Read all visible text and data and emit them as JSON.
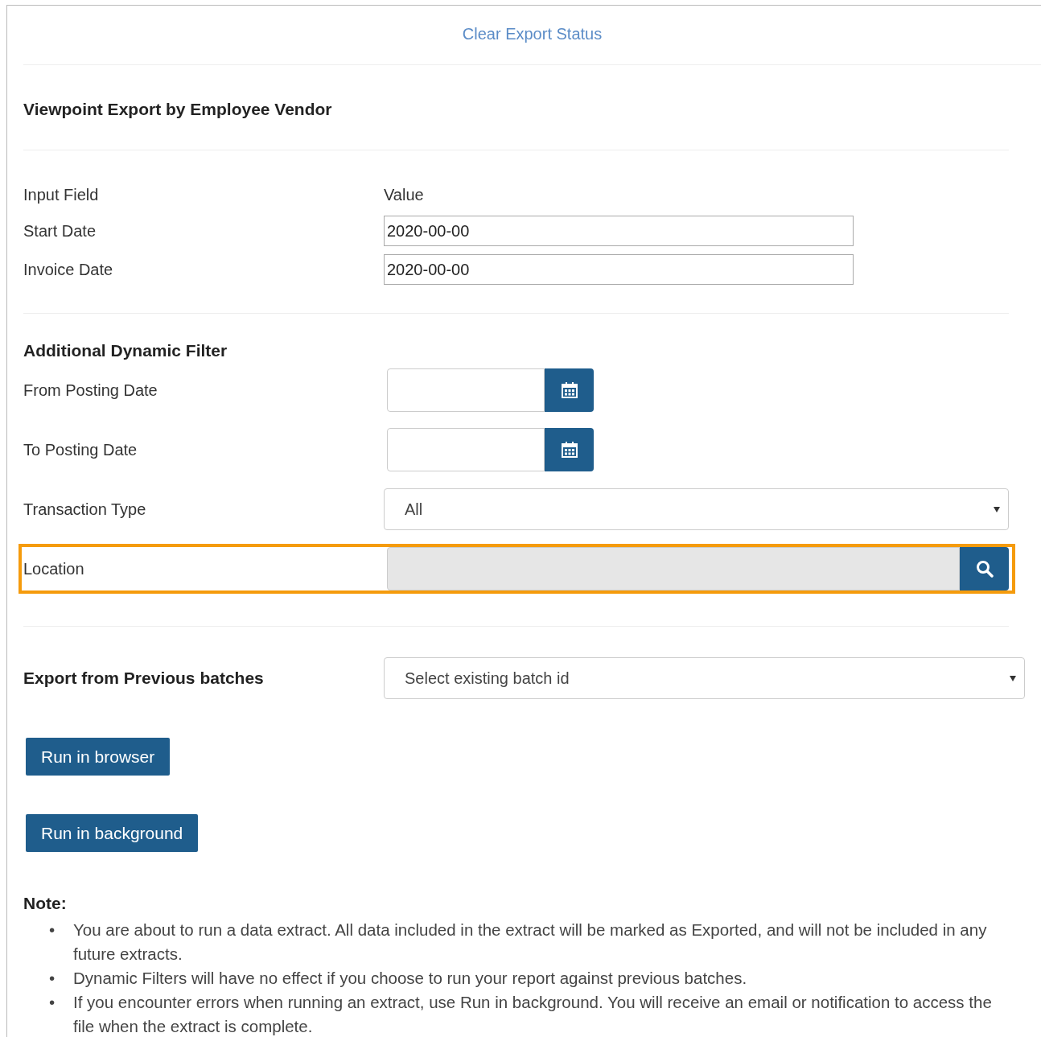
{
  "header": {
    "link": "Clear Export Status"
  },
  "export": {
    "title": "Viewpoint Export by Employee Vendor",
    "columns": [
      "Input Field",
      "Value"
    ],
    "fields": [
      {
        "label": "Start Date",
        "value": "2020-00-00"
      },
      {
        "label": "Invoice Date",
        "value": "2020-00-00"
      }
    ]
  },
  "dynamic_filter": {
    "title": "Additional Dynamic Filter",
    "filters": [
      {
        "kind": "date",
        "label": "From Posting Date",
        "highlighted": false
      },
      {
        "kind": "date",
        "label": "To Posting Date",
        "highlighted": false
      },
      {
        "kind": "select",
        "label": "Transaction Type",
        "value": "All",
        "highlighted": false
      },
      {
        "kind": "lookup",
        "label": "Location",
        "disabled": true,
        "highlighted": true
      }
    ]
  },
  "previous_batches": {
    "label": "Export from Previous batches",
    "value": "Select existing batch id"
  },
  "buttons": [
    "Run in browser",
    "Run in background"
  ],
  "note": {
    "title": "Note:",
    "items": [
      {
        "bullet": "•",
        "text": "You are about to run a data extract. All data included in the extract will be marked as Exported, and will not be included in any future extracts."
      },
      {
        "bullet": "•",
        "text": "Dynamic Filters will have no effect if you choose to run your report against previous batches."
      },
      {
        "bullet": "•",
        "text": "If you encounter errors when running an extract, use Run in background. You will receive an email or notification to access the file when the extract is complete."
      }
    ]
  }
}
